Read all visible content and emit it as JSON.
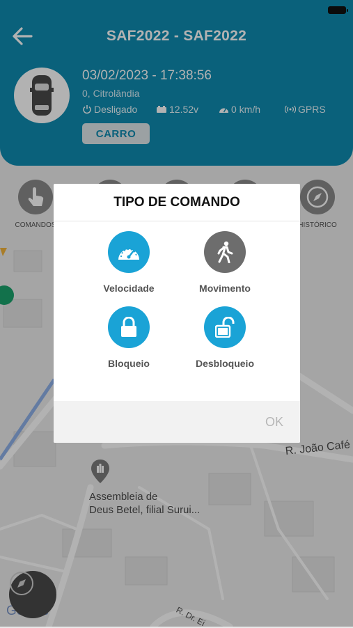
{
  "header": {
    "title": "SAF2022 - SAF2022",
    "datetime": "03/02/2023 - 17:38:56",
    "address": "0, Citrolândia",
    "ignition": "Desligado",
    "voltage": "12.52v",
    "speed": "0 km/h",
    "connection": "GPRS",
    "vehicle_button": "CARRO",
    "accent_color": "#0f8bb0"
  },
  "menu": {
    "items": [
      {
        "label": "COMANDOS",
        "icon": "hand-pointer-icon"
      },
      {
        "label": "HISTÓRICO",
        "icon": "compass-icon"
      }
    ]
  },
  "map": {
    "poi_line1": "Assembleia de",
    "poi_line2": "Deus Betel, filial Surui...",
    "street1": "R. João Café",
    "street2": "R. Dr. Ei",
    "attribution": "Google"
  },
  "dialog": {
    "title": "TIPO DE COMANDO",
    "commands": [
      {
        "label": "Velocidade",
        "icon": "speedometer-icon",
        "color": "#1aa3d6"
      },
      {
        "label": "Movimento",
        "icon": "walking-person-icon",
        "color": "#6d6d6d"
      },
      {
        "label": "Bloqueio",
        "icon": "lock-icon",
        "color": "#1aa3d6"
      },
      {
        "label": "Desbloqueio",
        "icon": "unlock-icon",
        "color": "#1aa3d6"
      }
    ],
    "ok_label": "OK"
  }
}
